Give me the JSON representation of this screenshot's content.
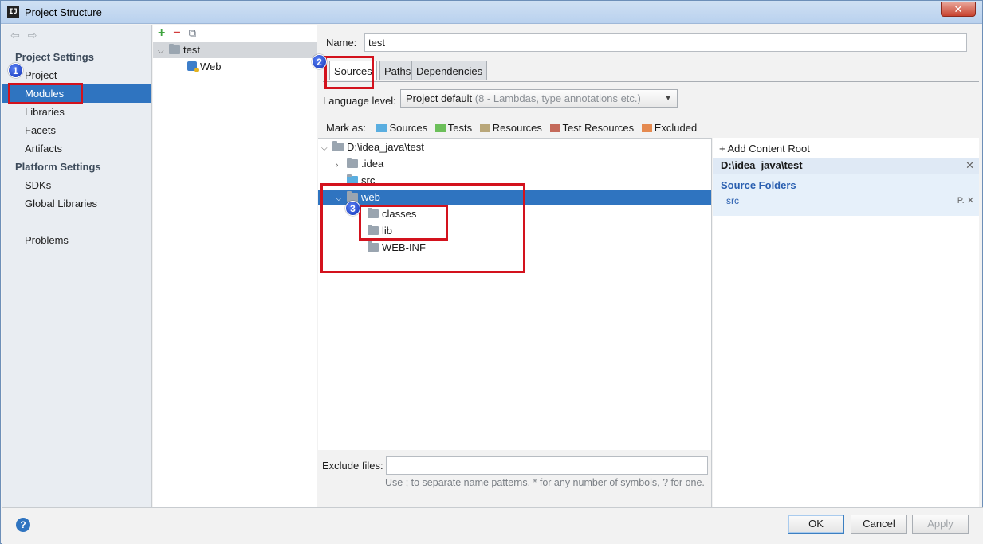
{
  "window": {
    "title": "Project Structure",
    "close_glyph": "✕"
  },
  "left": {
    "back_glyph": "⇦",
    "forward_glyph": "⇨",
    "project_settings_header": "Project Settings",
    "project_settings": [
      "Project",
      "Modules",
      "Libraries",
      "Facets",
      "Artifacts"
    ],
    "platform_settings_header": "Platform Settings",
    "platform_settings": [
      "SDKs",
      "Global Libraries"
    ],
    "problems": "Problems",
    "selected": "Modules"
  },
  "modules": {
    "toolbar": {
      "add": "+",
      "remove": "−",
      "copy": "⧉"
    },
    "tree": [
      {
        "label": "test",
        "expanded": true
      },
      {
        "label": "Web"
      }
    ]
  },
  "main": {
    "name_label": "Name:",
    "name_value": "test",
    "tabs": [
      "Sources",
      "Paths",
      "Dependencies"
    ],
    "active_tab": "Sources",
    "language_label": "Language level:",
    "language_value": "Project default",
    "language_hint": "(8 - Lambdas, type annotations etc.)",
    "mark_as_label": "Mark as:",
    "mark_as": [
      {
        "label": "Sources",
        "color": "#5aaee0"
      },
      {
        "label": "Tests",
        "color": "#6cbf5a"
      },
      {
        "label": "Resources",
        "color": "#b9a77a"
      },
      {
        "label": "Test Resources",
        "color": "#c46a5a"
      },
      {
        "label": "Excluded",
        "color": "#e58a50"
      }
    ],
    "tree": {
      "root": "D:\\idea_java\\test",
      "idea": ".idea",
      "src": "src",
      "web": "web",
      "classes": "classes",
      "lib": "lib",
      "webinf": "WEB-INF"
    },
    "exclude_label": "Exclude files:",
    "exclude_value": "",
    "exclude_hint": "Use ; to separate name patterns, * for any number of symbols, ? for one."
  },
  "roots": {
    "add_content_root": "Add Content Root",
    "content_root": "D:\\idea_java\\test",
    "source_folders_header": "Source Folders",
    "source_folder": "src",
    "remove_glyph": "✕",
    "edit_glyph": "P."
  },
  "buttons": {
    "ok": "OK",
    "cancel": "Cancel",
    "apply": "Apply",
    "help": "?"
  },
  "markers": [
    "1",
    "2",
    "3"
  ],
  "colors": {
    "selection": "#2f74c0",
    "annotation_red": "#d3121d",
    "marker_blue": "#1a3fd0"
  }
}
